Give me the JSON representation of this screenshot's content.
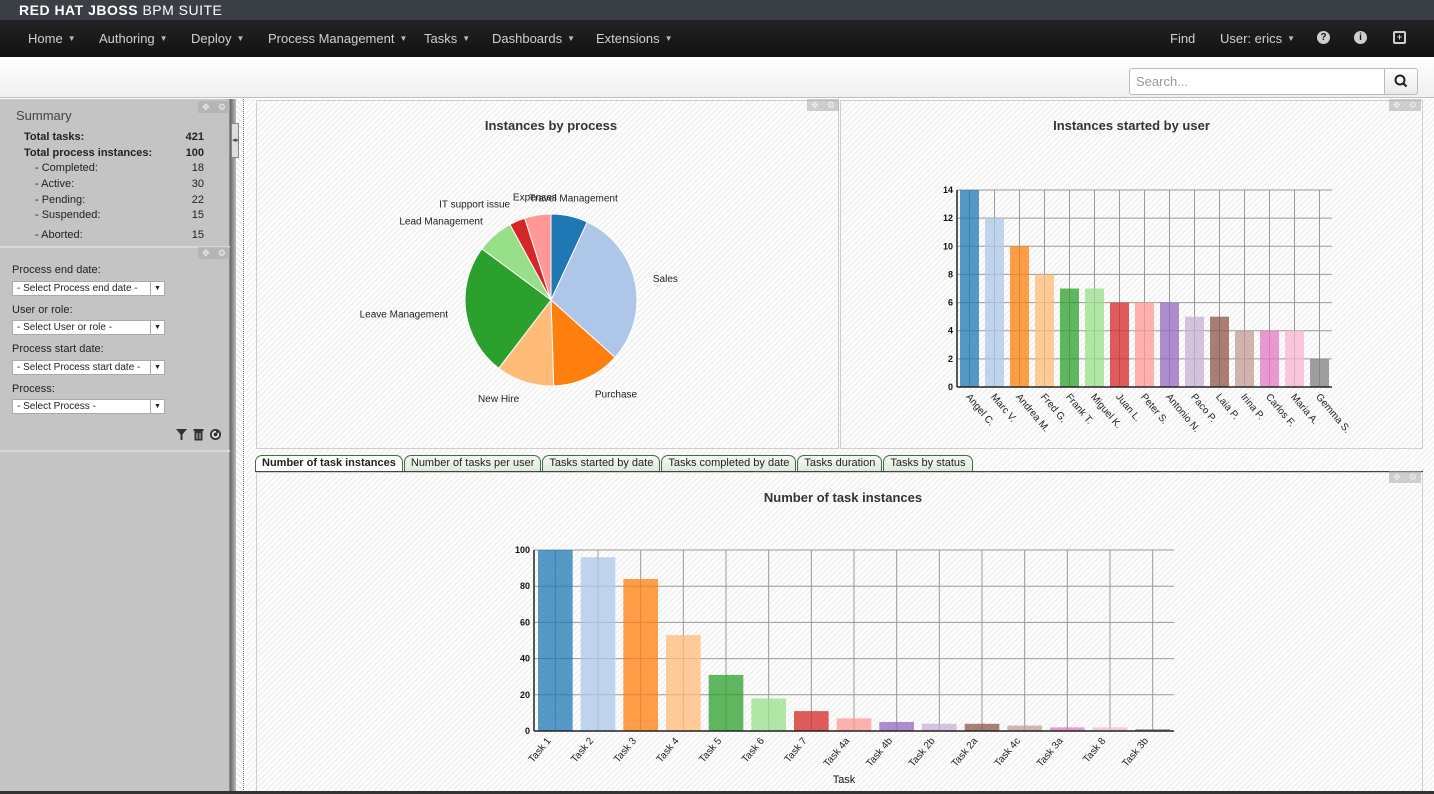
{
  "app": {
    "brand_bold": "RED HAT JBOSS",
    "brand_light": "BPM SUITE"
  },
  "nav": {
    "items": [
      {
        "label": "Home",
        "has_caret": true
      },
      {
        "label": "Authoring",
        "has_caret": true
      },
      {
        "label": "Deploy",
        "has_caret": true
      },
      {
        "label": "Process Management",
        "has_caret": true
      },
      {
        "label": "Tasks",
        "has_caret": true
      },
      {
        "label": "Dashboards",
        "has_caret": true
      },
      {
        "label": "Extensions",
        "has_caret": true
      }
    ],
    "find_label": "Find",
    "user_label": "User: erics",
    "icons": [
      "help-icon",
      "info-icon",
      "briefcase-icon"
    ]
  },
  "search": {
    "placeholder": "Search...",
    "value": ""
  },
  "summary": {
    "title": "Summary",
    "rows": [
      {
        "label": "Total tasks:",
        "value": "421",
        "bold": true
      },
      {
        "label": "Total process instances:",
        "value": "100",
        "bold": true
      },
      {
        "label": "- Completed:",
        "value": "18"
      },
      {
        "label": "- Active:",
        "value": "30"
      },
      {
        "label": "- Pending:",
        "value": "22"
      },
      {
        "label": "- Suspended:",
        "value": "15"
      },
      {
        "label": "- Aborted:",
        "value": "15"
      }
    ]
  },
  "filters": [
    {
      "label": "Process end date:",
      "selected": "- Select Process end date -"
    },
    {
      "label": "User or role:",
      "selected": "- Select User or role -"
    },
    {
      "label": "Process start date:",
      "selected": "- Select Process start date -"
    },
    {
      "label": "Process:",
      "selected": "- Select Process -"
    }
  ],
  "tabs": [
    {
      "label": "Number of task instances",
      "active": true
    },
    {
      "label": "Number of tasks per user"
    },
    {
      "label": "Tasks started by date"
    },
    {
      "label": "Tasks completed by date"
    },
    {
      "label": "Tasks duration"
    },
    {
      "label": "Tasks by status"
    }
  ],
  "chart_data": [
    {
      "type": "pie",
      "title": "Instances by process",
      "categories": [
        "Travel Management",
        "Sales",
        "Purchase",
        "New Hire",
        "Leave Management",
        "Lead Management",
        "IT support issue",
        "Expenses"
      ],
      "values": [
        7,
        30,
        13,
        11,
        25,
        7,
        3,
        5
      ],
      "colors": [
        "#1f77b4",
        "#aec7e8",
        "#ff7f0e",
        "#ffbb78",
        "#2ca02c",
        "#98df8a",
        "#d62728",
        "#ff9896"
      ]
    },
    {
      "type": "bar",
      "title": "Instances started by user",
      "categories": [
        "Angel C.",
        "Marc V.",
        "Andrea M.",
        "Fred G.",
        "Frank T.",
        "Miguel K.",
        "Juan L.",
        "Peter S.",
        "Antonio N.",
        "Paco P.",
        "Laia P.",
        "Irina P.",
        "Carlos F.",
        "Maria A.",
        "Gemma S."
      ],
      "values": [
        14,
        12,
        10,
        8,
        7,
        7,
        6,
        6,
        6,
        5,
        5,
        4,
        4,
        4,
        2
      ],
      "ylim": [
        0,
        14
      ],
      "yticks": [
        0,
        2,
        4,
        6,
        8,
        10,
        12,
        14
      ],
      "xlabel": "",
      "ylabel": "",
      "grid": true,
      "colors": [
        "#1f77b4",
        "#aec7e8",
        "#ff7f0e",
        "#ffbb78",
        "#2ca02c",
        "#98df8a",
        "#d62728",
        "#ff9896",
        "#9467bd",
        "#c5b0d5",
        "#8c564b",
        "#c49c94",
        "#e377c2",
        "#f7b6d2",
        "#7f7f7f"
      ]
    },
    {
      "type": "bar",
      "title": "Number of task instances",
      "categories": [
        "Task 1",
        "Task 2",
        "Task 3",
        "Task 4",
        "Task 5",
        "Task 6",
        "Task 7",
        "Task 4a",
        "Task 4b",
        "Task 2b",
        "Task 2a",
        "Task 4c",
        "Task 3a",
        "Task 8",
        "Task 3b"
      ],
      "values": [
        100,
        96,
        84,
        53,
        31,
        18,
        11,
        7,
        5,
        4,
        4,
        3,
        2,
        2,
        1
      ],
      "ylim": [
        0,
        100
      ],
      "yticks": [
        0,
        20,
        40,
        60,
        80,
        100
      ],
      "xlabel": "Task",
      "ylabel": "",
      "grid": true,
      "colors": [
        "#1f77b4",
        "#aec7e8",
        "#ff7f0e",
        "#ffbb78",
        "#2ca02c",
        "#98df8a",
        "#d62728",
        "#ff9896",
        "#9467bd",
        "#c5b0d5",
        "#8c564b",
        "#c49c94",
        "#e377c2",
        "#f7b6d2",
        "#7f7f7f"
      ]
    }
  ]
}
